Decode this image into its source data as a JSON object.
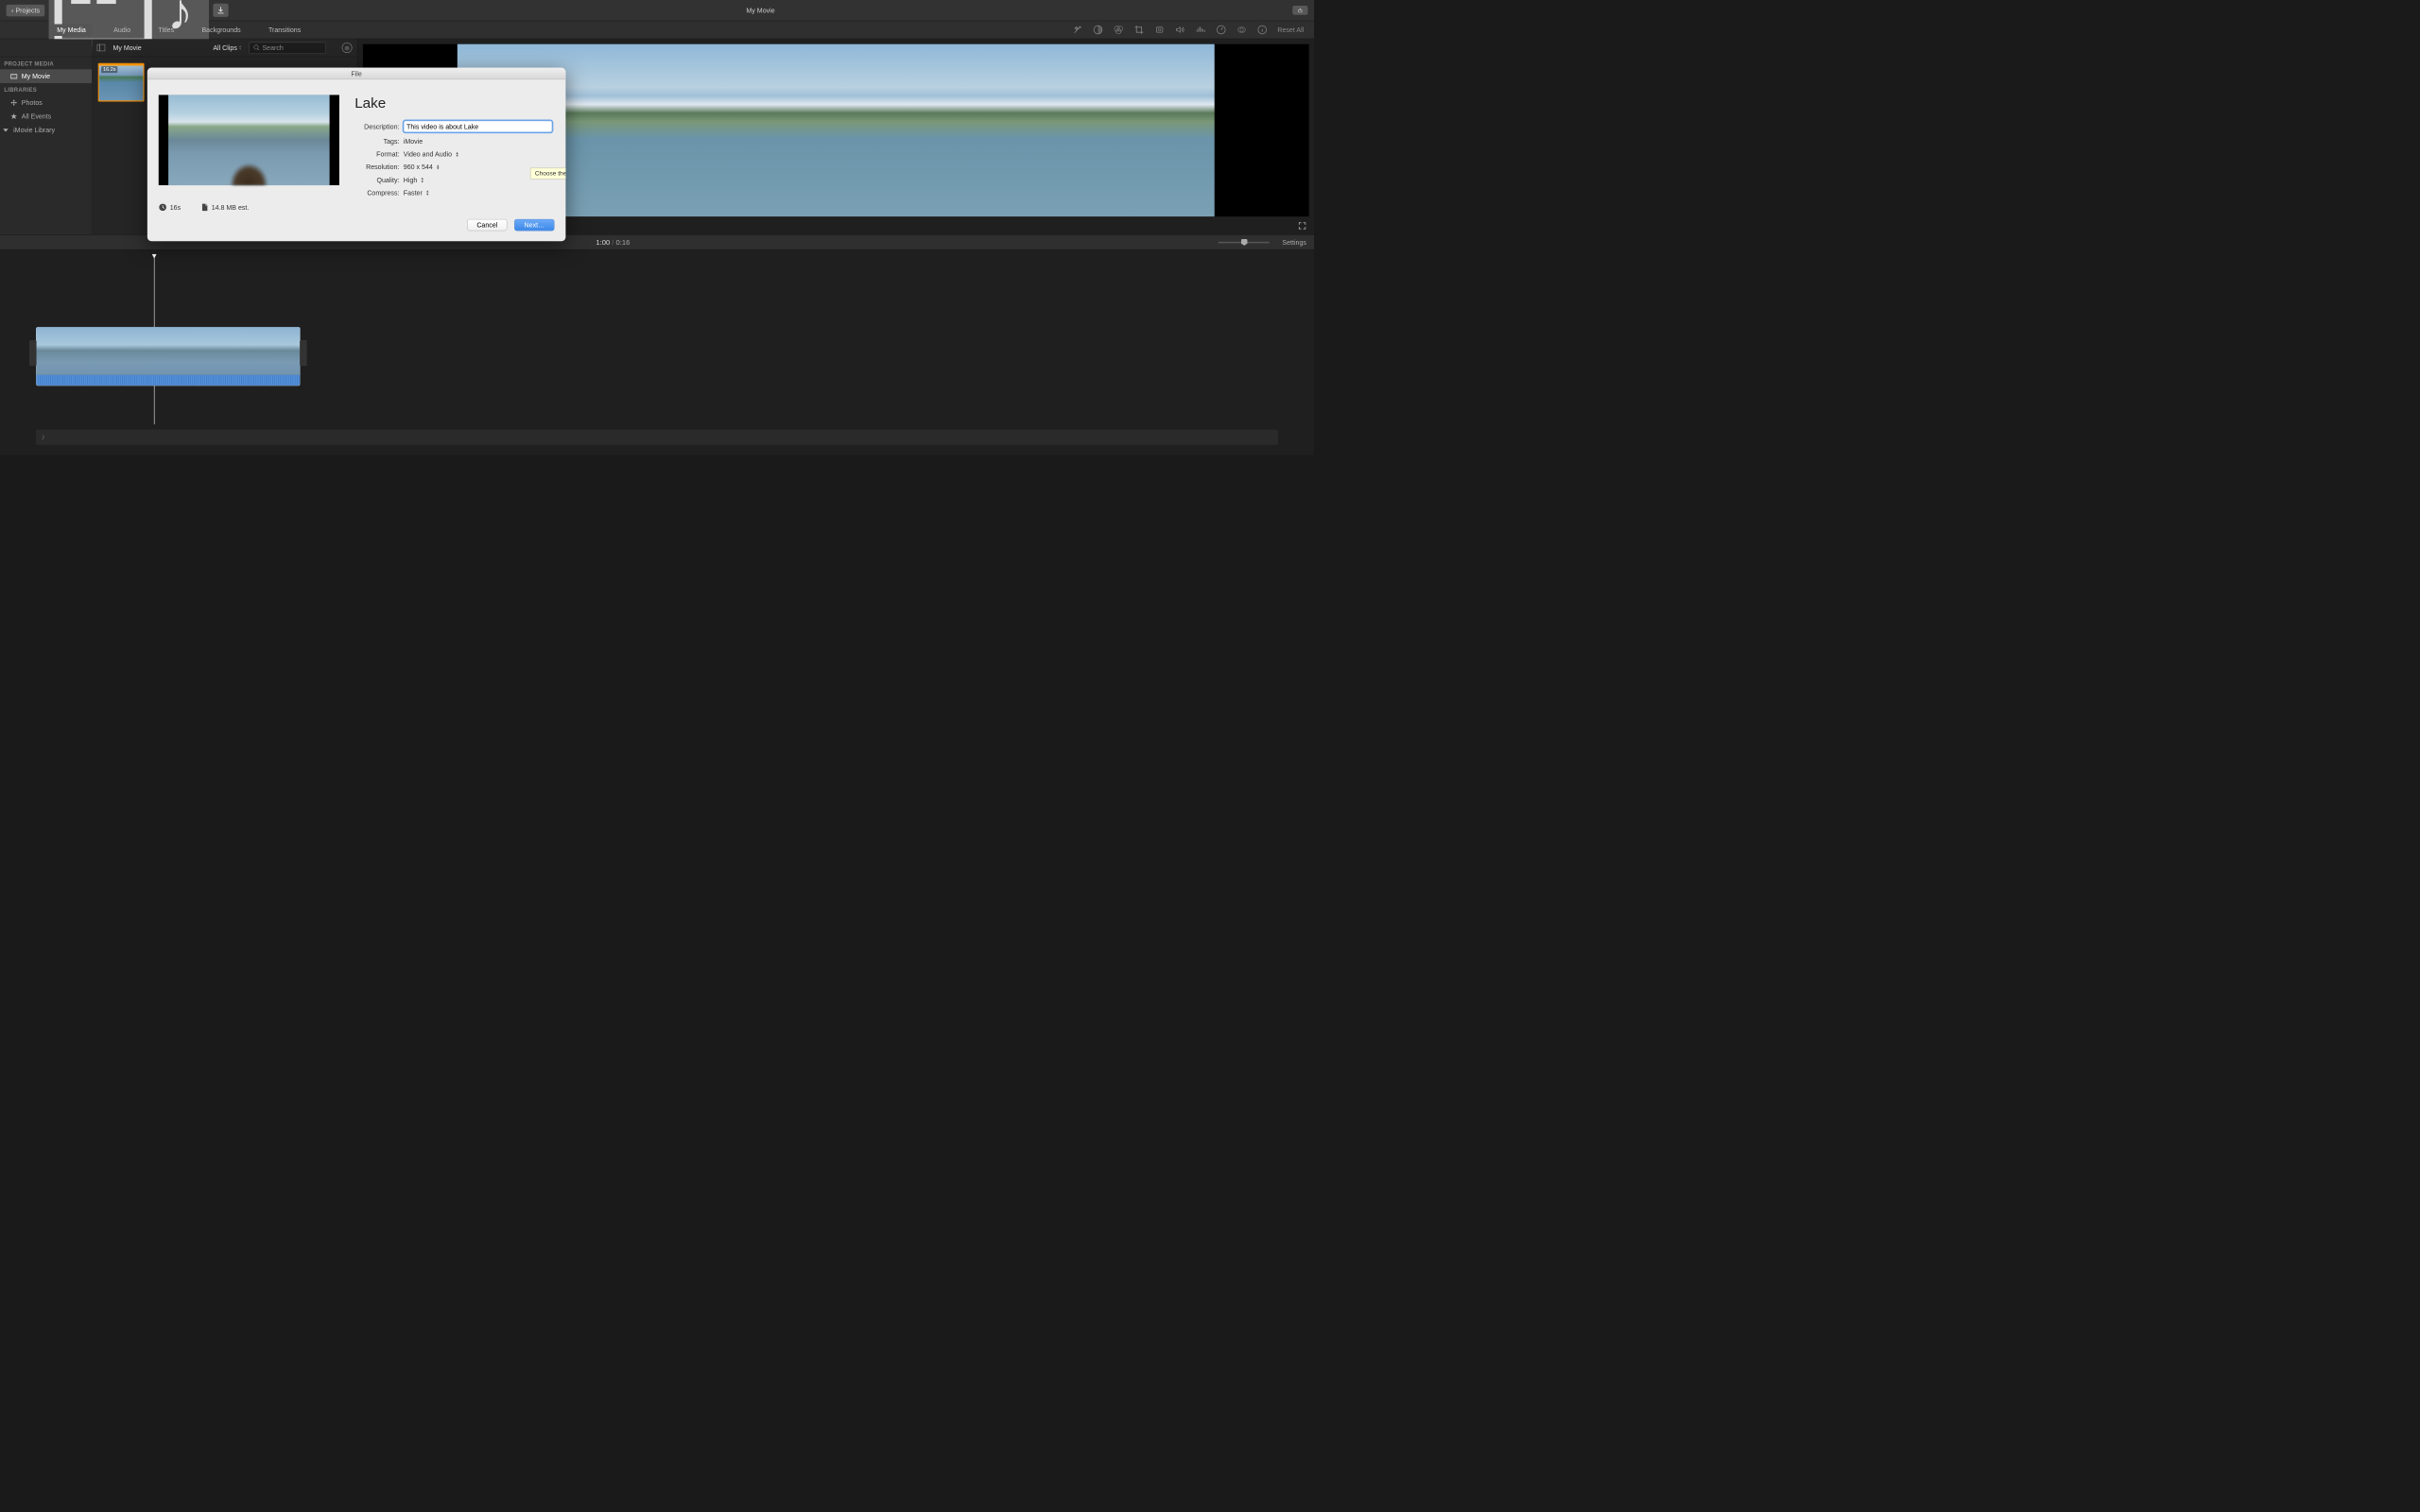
{
  "window": {
    "title": "My Movie",
    "projects_label": "Projects"
  },
  "tabs": [
    "My Media",
    "Audio",
    "Titles",
    "Backgrounds",
    "Transitions"
  ],
  "active_tab": "My Media",
  "reset_all": "Reset All",
  "sidebar": {
    "project_media_header": "PROJECT MEDIA",
    "project_name": "My Movie",
    "libraries_header": "LIBRARIES",
    "photos": "Photos",
    "all_events": "All Events",
    "library": "iMovie Library"
  },
  "browser": {
    "title": "My Movie",
    "clips_filter": "All Clips",
    "search_placeholder": "Search",
    "clip_duration": "16.2s"
  },
  "timeline": {
    "current_time": "1:00",
    "total_time": "0:16",
    "settings": "Settings"
  },
  "dialog": {
    "title": "File",
    "movie_title": "Lake",
    "description_label": "Description:",
    "description_value": "This video is about Lake",
    "tags_label": "Tags:",
    "tags_value": "iMovie",
    "format_label": "Format:",
    "format_value": "Video and Audio",
    "resolution_label": "Resolution:",
    "resolution_value": "960 x 544",
    "quality_label": "Quality:",
    "quality_value": "High",
    "compress_label": "Compress:",
    "compress_value": "Faster",
    "duration": "16s",
    "filesize": "14.8 MB est.",
    "tooltip": "Choose the video resolution",
    "cancel": "Cancel",
    "next": "Next…"
  }
}
